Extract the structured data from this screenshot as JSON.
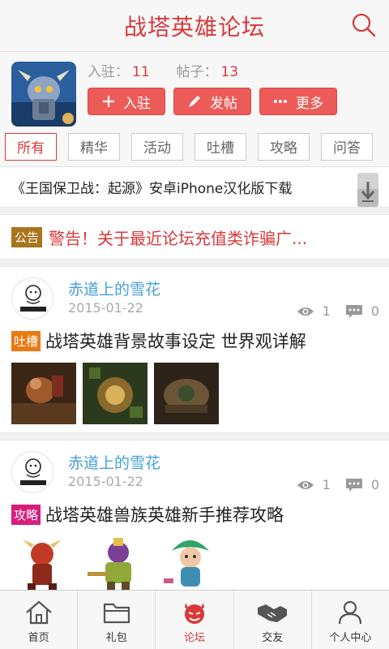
{
  "header": {
    "title": "战塔英雄论坛"
  },
  "forum": {
    "join_label": "入驻：",
    "join_count": "11",
    "posts_label": "帖子：",
    "posts_count": "13",
    "buttons": {
      "join": "入驻",
      "post": "发帖",
      "more": "更多"
    }
  },
  "tabs": [
    "所有",
    "精华",
    "活动",
    "吐槽",
    "攻略",
    "问答"
  ],
  "sticky": {
    "text": "《王国保卫战：起源》安卓iPhone汉化版下载"
  },
  "notice": {
    "badge": "公告",
    "text": "警告！关于最近论坛充值类诈骗广..."
  },
  "posts": [
    {
      "author": "赤道上的雪花",
      "date": "2015-01-22",
      "views": "1",
      "comments": "0",
      "tag": "吐槽",
      "tag_color": "#e87a14",
      "title": "战塔英雄背景故事设定 世界观详解"
    },
    {
      "author": "赤道上的雪花",
      "date": "2015-01-22",
      "views": "1",
      "comments": "0",
      "tag": "攻略",
      "tag_color": "#d61e7c",
      "title": "战塔英雄兽族英雄新手推荐攻略"
    }
  ],
  "nav": [
    "首页",
    "礼包",
    "论坛",
    "交友",
    "个人中心"
  ],
  "colors": {
    "accent": "#d9383a",
    "button": "#ec5b58",
    "link": "#44a0d8"
  }
}
